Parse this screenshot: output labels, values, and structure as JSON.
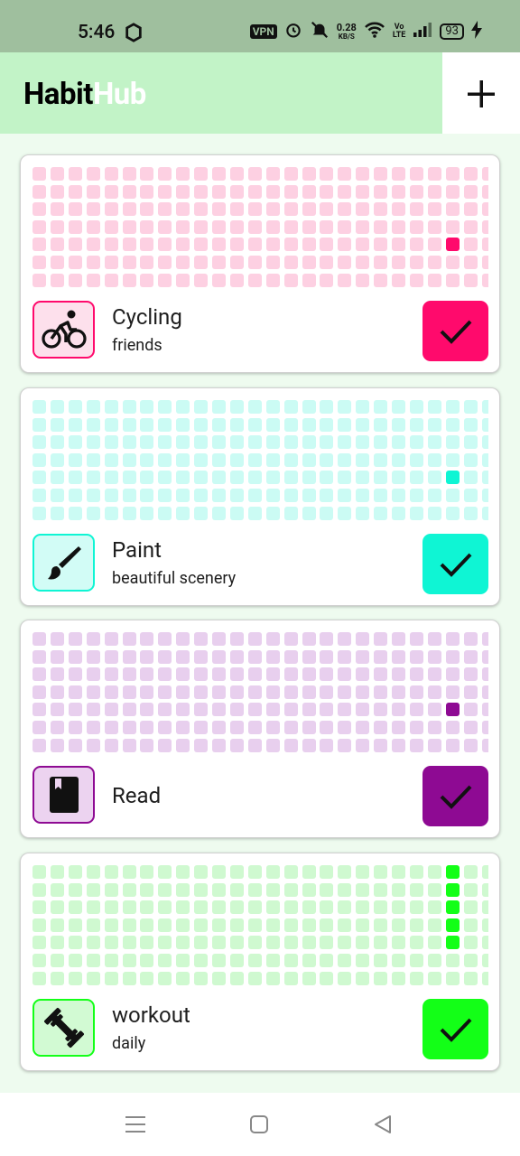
{
  "status_bar": {
    "time": "5:46",
    "vpn": "VPN",
    "speed_value": "0.28",
    "speed_unit": "KB/S",
    "volte_top": "Vo",
    "volte_bottom": "LTE",
    "battery": "93",
    "icons": [
      "shield-icon",
      "alarm-icon",
      "mute-icon",
      "wifi-icon",
      "signal-icon",
      "charging-icon"
    ]
  },
  "app_bar": {
    "title_part1": "Habit",
    "title_part2": "Hub",
    "add_icon": "plus-icon",
    "title_bg": "#c2f3c7"
  },
  "grid": {
    "rows": 7,
    "cols": 26
  },
  "habits": [
    {
      "name": "Cycling",
      "description": "friends",
      "icon": "bicycle-icon",
      "accent": "#ff0a6c",
      "light": "#fdd0e2",
      "icon_bg": "#fde0ec",
      "done_cells": [
        [
          4,
          23
        ]
      ]
    },
    {
      "name": "Paint",
      "description": "beautiful scenery",
      "icon": "brush-icon",
      "accent": "#0ff5d4",
      "light": "#cbfbf4",
      "icon_bg": "#d2fcf6",
      "done_cells": [
        [
          4,
          23
        ]
      ]
    },
    {
      "name": "Read",
      "description": "",
      "icon": "book-icon",
      "accent": "#8e0a93",
      "light": "#e8cfee",
      "icon_bg": "#ecd3f0",
      "done_cells": [
        [
          4,
          23
        ]
      ]
    },
    {
      "name": "workout",
      "description": "daily",
      "icon": "dumbbell-icon",
      "accent": "#13ff17",
      "light": "#cff9d0",
      "icon_bg": "#d2fad3",
      "done_cells": [
        [
          0,
          23
        ],
        [
          1,
          23
        ],
        [
          2,
          23
        ],
        [
          3,
          23
        ],
        [
          4,
          23
        ]
      ]
    }
  ],
  "nav_bar": {
    "icons": [
      "menu-icon",
      "home-square-icon",
      "back-triangle-icon"
    ]
  }
}
